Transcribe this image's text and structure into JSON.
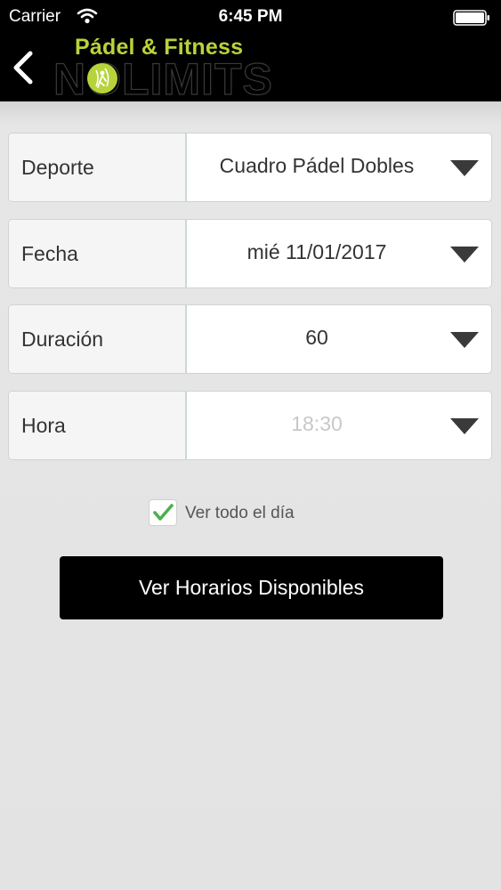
{
  "status_bar": {
    "carrier": "Carrier",
    "time": "6:45 PM",
    "icons": [
      "wifi-icon",
      "battery-icon"
    ]
  },
  "header": {
    "back_icon": "chevron-left-icon",
    "logo_top": "Pádel & Fitness",
    "logo_word": "NOLIMITS",
    "logo_color": "#b7d33b"
  },
  "form": {
    "rows": [
      {
        "label": "Deporte",
        "value": "Cuadro Pádel Dobles"
      },
      {
        "label": "Fecha",
        "value": "mié 11/01/2017"
      },
      {
        "label": "Duración",
        "value": "60"
      },
      {
        "label": "Hora",
        "value": "18:30",
        "disabled": true
      }
    ],
    "dropdown_icon": "triangle-down-icon",
    "checkbox": {
      "label": "Ver todo el día",
      "checked": true,
      "check_color": "#4caf50"
    },
    "submit_label": "Ver Horarios Disponibles"
  }
}
